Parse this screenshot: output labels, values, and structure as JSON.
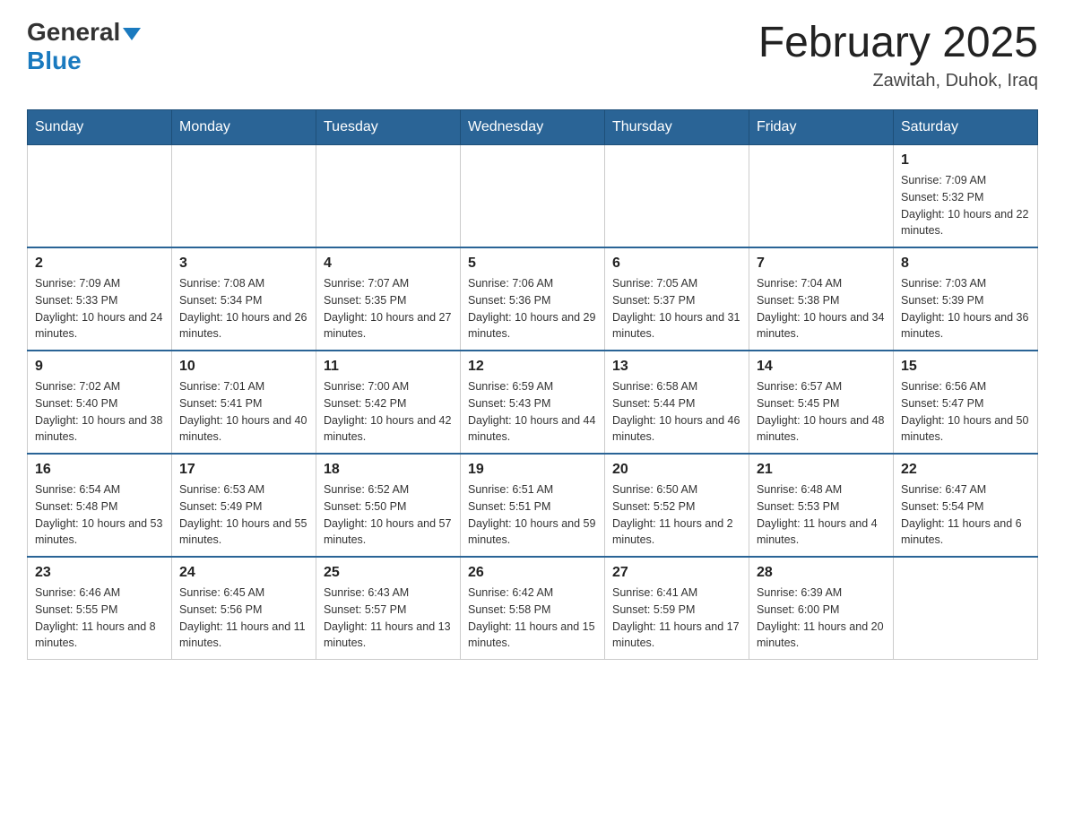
{
  "header": {
    "logo_general": "General",
    "logo_blue": "Blue",
    "month_title": "February 2025",
    "location": "Zawitah, Duhok, Iraq"
  },
  "days_of_week": [
    "Sunday",
    "Monday",
    "Tuesday",
    "Wednesday",
    "Thursday",
    "Friday",
    "Saturday"
  ],
  "weeks": [
    [
      {
        "day": "",
        "sunrise": "",
        "sunset": "",
        "daylight": ""
      },
      {
        "day": "",
        "sunrise": "",
        "sunset": "",
        "daylight": ""
      },
      {
        "day": "",
        "sunrise": "",
        "sunset": "",
        "daylight": ""
      },
      {
        "day": "",
        "sunrise": "",
        "sunset": "",
        "daylight": ""
      },
      {
        "day": "",
        "sunrise": "",
        "sunset": "",
        "daylight": ""
      },
      {
        "day": "",
        "sunrise": "",
        "sunset": "",
        "daylight": ""
      },
      {
        "day": "1",
        "sunrise": "Sunrise: 7:09 AM",
        "sunset": "Sunset: 5:32 PM",
        "daylight": "Daylight: 10 hours and 22 minutes."
      }
    ],
    [
      {
        "day": "2",
        "sunrise": "Sunrise: 7:09 AM",
        "sunset": "Sunset: 5:33 PM",
        "daylight": "Daylight: 10 hours and 24 minutes."
      },
      {
        "day": "3",
        "sunrise": "Sunrise: 7:08 AM",
        "sunset": "Sunset: 5:34 PM",
        "daylight": "Daylight: 10 hours and 26 minutes."
      },
      {
        "day": "4",
        "sunrise": "Sunrise: 7:07 AM",
        "sunset": "Sunset: 5:35 PM",
        "daylight": "Daylight: 10 hours and 27 minutes."
      },
      {
        "day": "5",
        "sunrise": "Sunrise: 7:06 AM",
        "sunset": "Sunset: 5:36 PM",
        "daylight": "Daylight: 10 hours and 29 minutes."
      },
      {
        "day": "6",
        "sunrise": "Sunrise: 7:05 AM",
        "sunset": "Sunset: 5:37 PM",
        "daylight": "Daylight: 10 hours and 31 minutes."
      },
      {
        "day": "7",
        "sunrise": "Sunrise: 7:04 AM",
        "sunset": "Sunset: 5:38 PM",
        "daylight": "Daylight: 10 hours and 34 minutes."
      },
      {
        "day": "8",
        "sunrise": "Sunrise: 7:03 AM",
        "sunset": "Sunset: 5:39 PM",
        "daylight": "Daylight: 10 hours and 36 minutes."
      }
    ],
    [
      {
        "day": "9",
        "sunrise": "Sunrise: 7:02 AM",
        "sunset": "Sunset: 5:40 PM",
        "daylight": "Daylight: 10 hours and 38 minutes."
      },
      {
        "day": "10",
        "sunrise": "Sunrise: 7:01 AM",
        "sunset": "Sunset: 5:41 PM",
        "daylight": "Daylight: 10 hours and 40 minutes."
      },
      {
        "day": "11",
        "sunrise": "Sunrise: 7:00 AM",
        "sunset": "Sunset: 5:42 PM",
        "daylight": "Daylight: 10 hours and 42 minutes."
      },
      {
        "day": "12",
        "sunrise": "Sunrise: 6:59 AM",
        "sunset": "Sunset: 5:43 PM",
        "daylight": "Daylight: 10 hours and 44 minutes."
      },
      {
        "day": "13",
        "sunrise": "Sunrise: 6:58 AM",
        "sunset": "Sunset: 5:44 PM",
        "daylight": "Daylight: 10 hours and 46 minutes."
      },
      {
        "day": "14",
        "sunrise": "Sunrise: 6:57 AM",
        "sunset": "Sunset: 5:45 PM",
        "daylight": "Daylight: 10 hours and 48 minutes."
      },
      {
        "day": "15",
        "sunrise": "Sunrise: 6:56 AM",
        "sunset": "Sunset: 5:47 PM",
        "daylight": "Daylight: 10 hours and 50 minutes."
      }
    ],
    [
      {
        "day": "16",
        "sunrise": "Sunrise: 6:54 AM",
        "sunset": "Sunset: 5:48 PM",
        "daylight": "Daylight: 10 hours and 53 minutes."
      },
      {
        "day": "17",
        "sunrise": "Sunrise: 6:53 AM",
        "sunset": "Sunset: 5:49 PM",
        "daylight": "Daylight: 10 hours and 55 minutes."
      },
      {
        "day": "18",
        "sunrise": "Sunrise: 6:52 AM",
        "sunset": "Sunset: 5:50 PM",
        "daylight": "Daylight: 10 hours and 57 minutes."
      },
      {
        "day": "19",
        "sunrise": "Sunrise: 6:51 AM",
        "sunset": "Sunset: 5:51 PM",
        "daylight": "Daylight: 10 hours and 59 minutes."
      },
      {
        "day": "20",
        "sunrise": "Sunrise: 6:50 AM",
        "sunset": "Sunset: 5:52 PM",
        "daylight": "Daylight: 11 hours and 2 minutes."
      },
      {
        "day": "21",
        "sunrise": "Sunrise: 6:48 AM",
        "sunset": "Sunset: 5:53 PM",
        "daylight": "Daylight: 11 hours and 4 minutes."
      },
      {
        "day": "22",
        "sunrise": "Sunrise: 6:47 AM",
        "sunset": "Sunset: 5:54 PM",
        "daylight": "Daylight: 11 hours and 6 minutes."
      }
    ],
    [
      {
        "day": "23",
        "sunrise": "Sunrise: 6:46 AM",
        "sunset": "Sunset: 5:55 PM",
        "daylight": "Daylight: 11 hours and 8 minutes."
      },
      {
        "day": "24",
        "sunrise": "Sunrise: 6:45 AM",
        "sunset": "Sunset: 5:56 PM",
        "daylight": "Daylight: 11 hours and 11 minutes."
      },
      {
        "day": "25",
        "sunrise": "Sunrise: 6:43 AM",
        "sunset": "Sunset: 5:57 PM",
        "daylight": "Daylight: 11 hours and 13 minutes."
      },
      {
        "day": "26",
        "sunrise": "Sunrise: 6:42 AM",
        "sunset": "Sunset: 5:58 PM",
        "daylight": "Daylight: 11 hours and 15 minutes."
      },
      {
        "day": "27",
        "sunrise": "Sunrise: 6:41 AM",
        "sunset": "Sunset: 5:59 PM",
        "daylight": "Daylight: 11 hours and 17 minutes."
      },
      {
        "day": "28",
        "sunrise": "Sunrise: 6:39 AM",
        "sunset": "Sunset: 6:00 PM",
        "daylight": "Daylight: 11 hours and 20 minutes."
      },
      {
        "day": "",
        "sunrise": "",
        "sunset": "",
        "daylight": ""
      }
    ]
  ]
}
